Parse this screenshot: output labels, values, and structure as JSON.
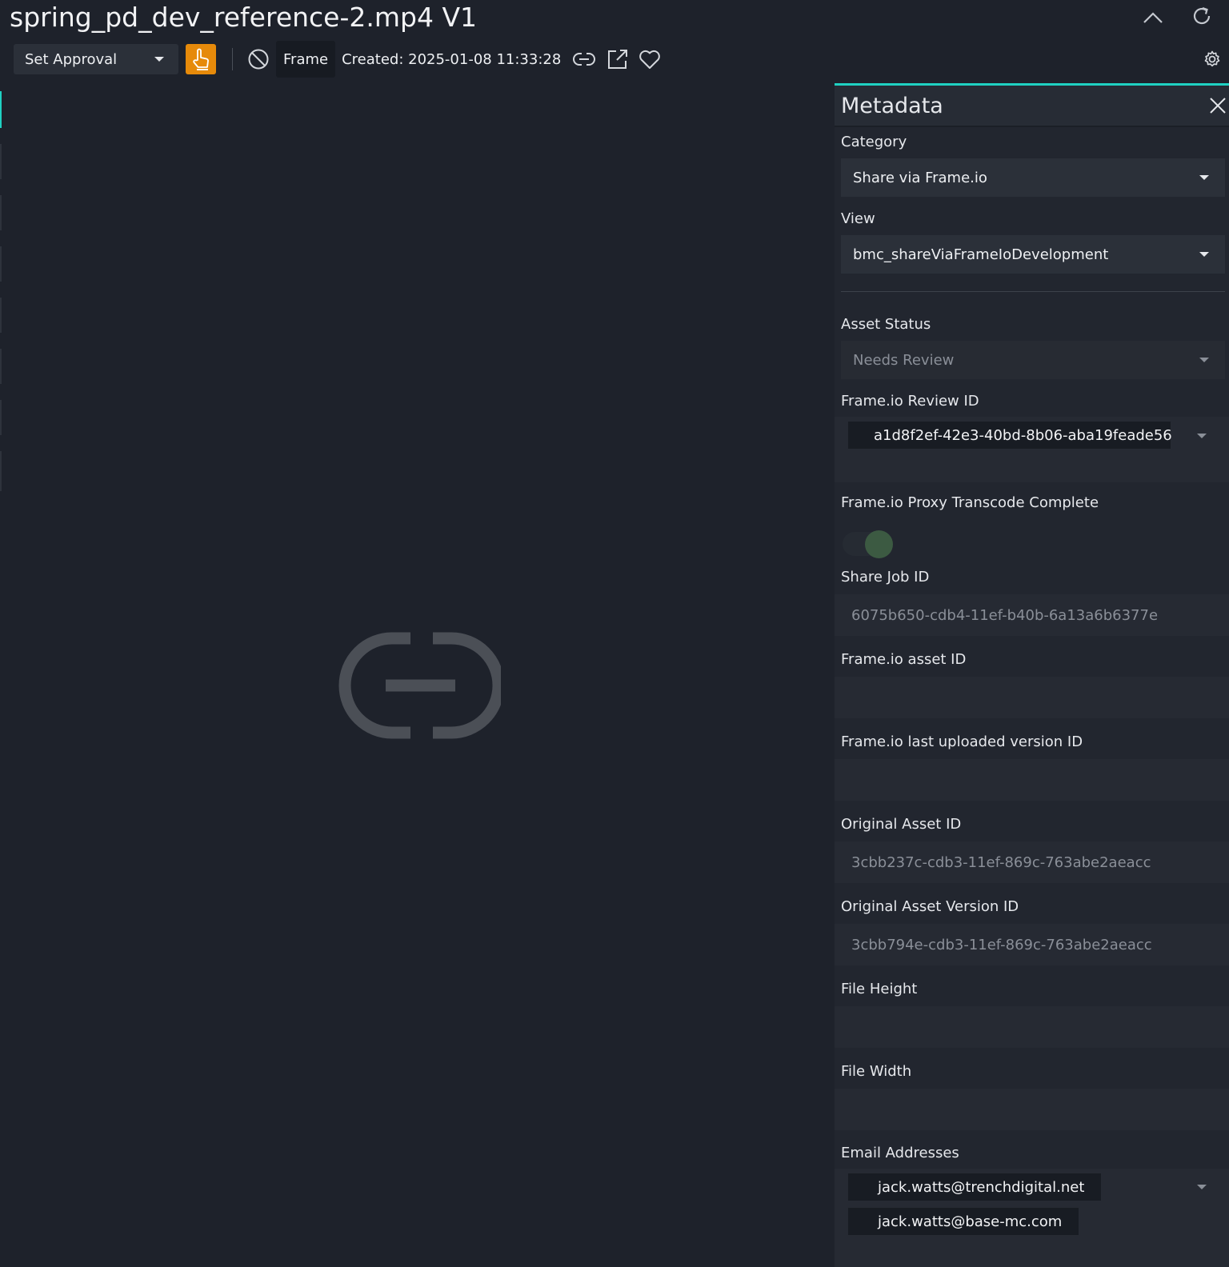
{
  "header": {
    "title": "spring_pd_dev_reference-2.mp4 V1"
  },
  "toolbar": {
    "approval_label": "Set Approval",
    "frame_label": "Frame",
    "created_label": "Created: 2025-01-08 11:33:28"
  },
  "colors": {
    "accent": "#1fd1c2",
    "approve": "#e68a0a",
    "background": "#1e222b",
    "panel": "#22262f"
  },
  "icons": {
    "collapse": "chevron-up-icon",
    "refresh": "refresh-icon",
    "settings": "gear-icon",
    "approve": "hand-pointer-icon",
    "block": "block-icon",
    "link": "link-icon",
    "open_external": "external-link-icon",
    "favorite": "heart-icon",
    "close": "close-icon",
    "placeholder": "link-icon"
  },
  "metadata": {
    "title": "Metadata",
    "category": {
      "label": "Category",
      "value": "Share via Frame.io"
    },
    "view": {
      "label": "View",
      "value": "bmc_shareViaFrameIoDevelopment"
    },
    "asset_status": {
      "label": "Asset Status",
      "value": "Needs Review"
    },
    "review_id": {
      "label": "Frame.io Review ID",
      "value": "a1d8f2ef-42e3-40bd-8b06-aba19feade56"
    },
    "proxy_transcode": {
      "label": "Frame.io Proxy Transcode Complete",
      "value": true
    },
    "share_job_id": {
      "label": "Share Job ID",
      "value": "6075b650-cdb4-11ef-b40b-6a13a6b6377e"
    },
    "asset_id": {
      "label": "Frame.io asset ID",
      "value": ""
    },
    "last_version_id": {
      "label": "Frame.io last uploaded version ID",
      "value": ""
    },
    "original_asset_id": {
      "label": "Original Asset ID",
      "value": "3cbb237c-cdb3-11ef-869c-763abe2aeacc"
    },
    "original_asset_version_id": {
      "label": "Original Asset Version ID",
      "value": "3cbb794e-cdb3-11ef-869c-763abe2aeacc"
    },
    "file_height": {
      "label": "File Height",
      "value": ""
    },
    "file_width": {
      "label": "File Width",
      "value": ""
    },
    "email_addresses": {
      "label": "Email Addresses",
      "values": [
        "jack.watts@trenchdigital.net",
        "jack.watts@base-mc.com"
      ]
    }
  }
}
